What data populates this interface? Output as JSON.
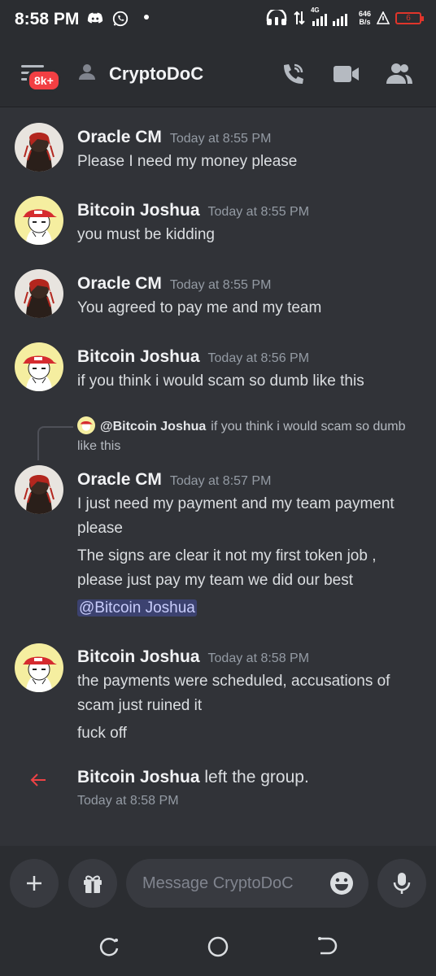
{
  "status_bar": {
    "time": "8:58 PM",
    "network_type": "4G",
    "net_speed_value": "646",
    "net_speed_unit": "B/s",
    "battery": "6"
  },
  "header": {
    "badge": "8k+",
    "title": "CryptoDoC"
  },
  "messages": [
    {
      "user": "Oracle CM",
      "time": "Today at 8:55 PM",
      "lines": [
        "Please I need my money please"
      ]
    },
    {
      "user": "Bitcoin Joshua",
      "time": "Today at 8:55 PM",
      "lines": [
        "you must be kidding"
      ]
    },
    {
      "user": "Oracle CM",
      "time": "Today at 8:55 PM",
      "lines": [
        "You agreed to pay me and my team"
      ]
    },
    {
      "user": "Bitcoin Joshua",
      "time": "Today at 8:56 PM",
      "lines": [
        "if you think i would scam so dumb like this"
      ]
    },
    {
      "reply": {
        "user": "@Bitcoin Joshua",
        "text": "if you think i would scam so dumb like this"
      },
      "user": "Oracle CM",
      "time": "Today at 8:57 PM",
      "lines": [
        "I just need my payment and my team payment please",
        "The signs are clear it not my first token job , please just pay my team we did our best"
      ],
      "mention": "@Bitcoin Joshua"
    },
    {
      "user": "Bitcoin Joshua",
      "time": "Today at 8:58 PM",
      "lines": [
        "the payments were scheduled, accusations of scam just ruined it",
        "fuck off"
      ]
    }
  ],
  "system": {
    "user": "Bitcoin Joshua",
    "text": "left the group.",
    "time": "Today at 8:58 PM"
  },
  "composer": {
    "placeholder": "Message CryptoDoC"
  },
  "colors": {
    "background": "#313338",
    "header": "#2b2d31",
    "badge": "#f23f43",
    "mention_bg": "#3c4270",
    "leave_arrow": "#ed4245"
  }
}
